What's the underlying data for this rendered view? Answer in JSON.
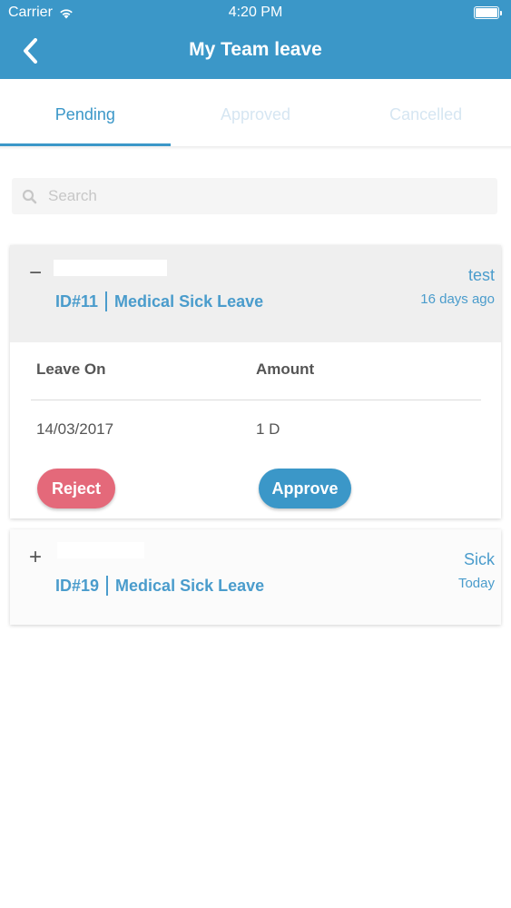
{
  "status_bar": {
    "carrier": "Carrier",
    "time": "4:20 PM"
  },
  "header": {
    "title": "My Team leave",
    "back_icon": "chevron-left-icon"
  },
  "tabs": [
    {
      "label": "Pending",
      "active": true
    },
    {
      "label": "Approved",
      "active": false
    },
    {
      "label": "Cancelled",
      "active": false
    }
  ],
  "search": {
    "placeholder": "Search",
    "value": ""
  },
  "columns": {
    "leave_on": "Leave On",
    "amount": "Amount"
  },
  "requests": [
    {
      "toggle": "−",
      "id": "ID#11",
      "type": "Medical Sick Leave",
      "reason": "test",
      "age": "16 days ago",
      "expanded": true,
      "leave_on": "14/03/2017",
      "amount": "1 D",
      "reject_label": "Reject",
      "approve_label": "Approve"
    },
    {
      "toggle": "+",
      "id": "ID#19",
      "type": "Medical Sick Leave",
      "reason": "Sick",
      "age": "Today",
      "expanded": false
    }
  ],
  "colors": {
    "primary": "#3b97c8",
    "reject": "#e4697a",
    "link_text": "#4a9ccc",
    "inactive_tab": "#d6e6f2"
  }
}
